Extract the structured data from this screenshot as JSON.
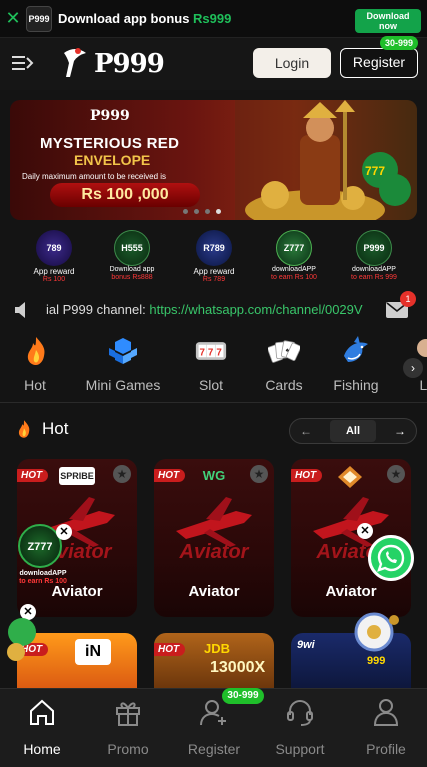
{
  "download_bar": {
    "close_icon": "close-icon",
    "logo_text": "P999",
    "text_prefix": "Download app bonus ",
    "text_amount": "Rs999",
    "button_label_1": "Download",
    "button_label_2": "now",
    "accent": "#1fbf5a"
  },
  "header": {
    "menu_icon": "menu-arrow-icon",
    "logo_text": "P999",
    "login_label": "Login",
    "register_label": "Register",
    "register_badge": "30-999"
  },
  "banner": {
    "logo_text": "P999",
    "title_line1": "MYSTERIOUS RED",
    "title_line2": "ENVELOPE",
    "subtitle": "Daily maximum amount to be received is",
    "amount": "Rs 100 ,000",
    "slide_count": 4,
    "active_slide": 4
  },
  "apps": [
    {
      "icon_text": "789",
      "line1": "App reward",
      "line2": "Rs 100"
    },
    {
      "icon_text": "H555",
      "line1": "Download app",
      "line2": "bonus Rs888"
    },
    {
      "icon_text": "R789",
      "line1": "App reward",
      "line2": "Rs 789"
    },
    {
      "icon_text": "Z777",
      "line1": "downloadAPP",
      "line2": "to earn Rs 100"
    },
    {
      "icon_text": "P999",
      "line1": "downloadAPP",
      "line2": "to earn Rs 999"
    }
  ],
  "marquee": {
    "text": "ial P999 channel: ",
    "link": "https://whatsapp.com/channel/0029V",
    "mail_badge": "1"
  },
  "categories": [
    {
      "label": "Hot",
      "icon": "fire-icon"
    },
    {
      "label": "Mini Games",
      "icon": "cubes-icon"
    },
    {
      "label": "Slot",
      "icon": "slot-777-icon"
    },
    {
      "label": "Cards",
      "icon": "playing-cards-icon"
    },
    {
      "label": "Fishing",
      "icon": "shark-icon"
    },
    {
      "label": "Li",
      "icon": "live-icon"
    }
  ],
  "hot_section": {
    "title": "Hot",
    "pager_all": "All",
    "prev_icon": "arrow-left-icon",
    "next_icon": "arrow-right-icon"
  },
  "games": [
    {
      "name": "Aviator",
      "provider": "SPRIBE",
      "badge": "HOT"
    },
    {
      "name": "Aviator",
      "provider": "WG",
      "badge": "HOT"
    },
    {
      "name": "Aviator",
      "provider": "",
      "badge": "HOT"
    }
  ],
  "games_row2": [
    {
      "label": "",
      "badge": "HOT"
    },
    {
      "label": "13000X",
      "badge": "HOT"
    },
    {
      "label": "999",
      "badge": ""
    }
  ],
  "floating": {
    "z777_line1": "downloadAPP",
    "z777_line2": "to earn Rs 100"
  },
  "bottom_nav": [
    {
      "label": "Home",
      "icon": "home-icon",
      "active": true
    },
    {
      "label": "Promo",
      "icon": "gift-icon",
      "active": false
    },
    {
      "label": "Register",
      "icon": "user-add-icon",
      "active": false
    },
    {
      "label": "Support",
      "icon": "headset-icon",
      "active": false
    },
    {
      "label": "Profile",
      "icon": "person-icon",
      "active": false
    }
  ],
  "nav_badge": "30-999"
}
